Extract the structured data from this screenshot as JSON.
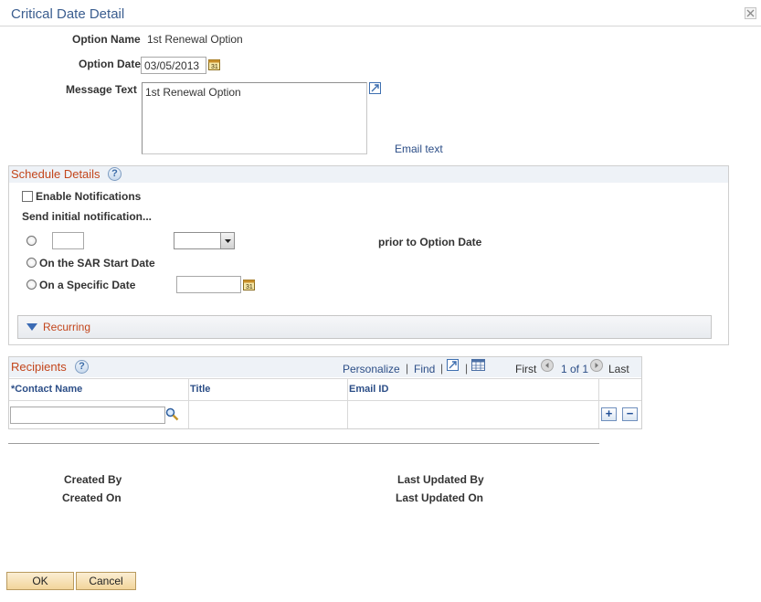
{
  "window": {
    "title": "Critical Date Detail"
  },
  "form": {
    "option_name_label": "Option Name",
    "option_name_value": "1st Renewal Option",
    "option_date_label": "Option Date",
    "option_date_value": "03/05/2013",
    "message_text_label": "Message Text",
    "message_text_value": "1st Renewal Option",
    "email_text_link": "Email text"
  },
  "schedule": {
    "title": "Schedule Details",
    "enable_notifications_label": "Enable Notifications",
    "send_initial_label": "Send initial notification...",
    "prior_to_label": "prior to Option Date",
    "sar_start_label": "On the SAR Start Date",
    "specific_date_label": "On a Specific Date",
    "recurring_label": "Recurring"
  },
  "recipients": {
    "title": "Recipients",
    "personalize": "Personalize",
    "find": "Find",
    "separator": "|",
    "first": "First",
    "pager": "1 of 1",
    "last": "Last",
    "columns": [
      "*Contact Name",
      "Title",
      "Email ID"
    ]
  },
  "audit": {
    "created_by": "Created By",
    "created_on": "Created On",
    "last_updated_by": "Last Updated By",
    "last_updated_on": "Last Updated On"
  },
  "buttons": {
    "ok": "OK",
    "cancel": "Cancel"
  },
  "icons": {
    "close": "close-icon",
    "calendar": "calendar-icon",
    "expand": "expand-icon",
    "help": "help-icon",
    "search": "search-icon",
    "triangle": "triangle-down-icon",
    "add_row": "plus-icon",
    "delete_row": "minus-icon"
  },
  "colors": {
    "title": "#3a5d8f",
    "section_title": "#c3461c",
    "link": "#2c4e87",
    "button_bg": "#f2d59b"
  }
}
